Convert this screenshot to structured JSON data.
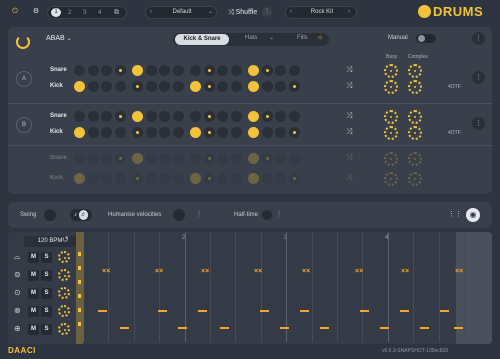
{
  "header": {
    "pages": [
      "1",
      "2",
      "3",
      "4"
    ],
    "preset": "Default",
    "shuffle_label": "Shuffle",
    "kit": "Rock Kit",
    "logo_text": "DRUMS",
    "brand_color": "#f3c23a"
  },
  "pattern": {
    "form": "ABAB",
    "tabs": [
      "Kick & Snare",
      "Hats",
      "Fills"
    ],
    "manual_label": "Manual",
    "col_busy": "Busy",
    "col_complex": "Complex",
    "sections": [
      {
        "label": "A",
        "rows": [
          {
            "name": "Snare",
            "tag": ""
          },
          {
            "name": "Kick",
            "tag": "4OTF"
          }
        ]
      },
      {
        "label": "B",
        "rows": [
          {
            "name": "Snare",
            "tag": ""
          },
          {
            "name": "Kick",
            "tag": "4OTF"
          }
        ]
      },
      {
        "label": "",
        "rows": [
          {
            "name": "Snare",
            "tag": ""
          },
          {
            "name": "Kick",
            "tag": ""
          }
        ]
      }
    ]
  },
  "controls": {
    "swing_label": "Swing",
    "humanise_label": "Humanise velocities",
    "halftime_label": "Half-time"
  },
  "piano_roll": {
    "bpm": "120 BPM",
    "bar_numbers": [
      "2",
      "3",
      "4"
    ],
    "tracks": [
      "M",
      "S"
    ]
  },
  "footer": {
    "brand": "DAACI",
    "version": "v0.5.3-SNAPSHOT-135ec833"
  }
}
